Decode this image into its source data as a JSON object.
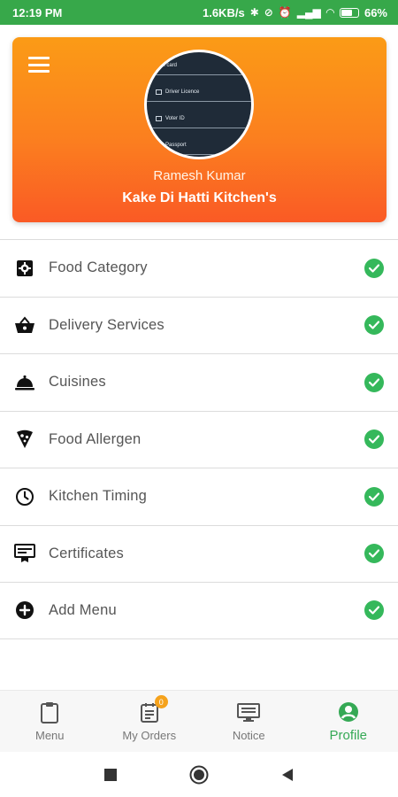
{
  "status_bar": {
    "time": "12:19 PM",
    "network_speed": "1.6KB/s",
    "battery": "66%"
  },
  "header": {
    "profile_name": "Ramesh Kumar",
    "kitchen_name": "Kake Di Hatti Kitchen's",
    "avatar_rows": [
      "Pan card",
      "Driver Licence",
      "Voter ID",
      "Passport"
    ]
  },
  "menu": {
    "items": [
      {
        "label": "Food Category",
        "icon": "food-category-icon",
        "done": true
      },
      {
        "label": "Delivery Services",
        "icon": "basket-icon",
        "done": true
      },
      {
        "label": "Cuisines",
        "icon": "cloche-icon",
        "done": true
      },
      {
        "label": "Food Allergen",
        "icon": "pizza-slice-icon",
        "done": true
      },
      {
        "label": "Kitchen Timing",
        "icon": "clock-icon",
        "done": true
      },
      {
        "label": "Certificates",
        "icon": "certificate-icon",
        "done": true
      },
      {
        "label": "Add Menu",
        "icon": "add-circle-icon",
        "done": true
      }
    ]
  },
  "bottom_nav": {
    "items": [
      {
        "label": "Menu",
        "icon": "clipboard-icon"
      },
      {
        "label": "My Orders",
        "icon": "orders-icon",
        "badge": "0"
      },
      {
        "label": "Notice",
        "icon": "notice-icon"
      },
      {
        "label": "Profile",
        "icon": "profile-icon",
        "active": true
      }
    ]
  },
  "colors": {
    "status_bar": "#37a84a",
    "header_top": "#fb9b16",
    "header_bottom": "#fa5a25",
    "check": "#35b85b",
    "active_nav": "#35a955"
  }
}
